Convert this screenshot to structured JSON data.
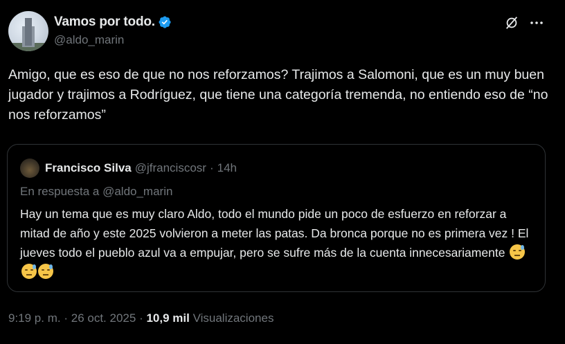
{
  "author": {
    "display_name": "Vamos por todo.",
    "handle": "@aldo_marin"
  },
  "tweet_text": "Amigo, que es eso de que no nos reforzamos?  Trajimos a Salomoni, que es un muy buen jugador y trajimos a Rodríguez, que tiene una categoría tremenda, no entiendo eso de “no nos reforzamos”",
  "quote": {
    "display_name": "Francisco Silva",
    "handle": "@jfranciscosr",
    "separator": "·",
    "time": "14h",
    "reply_to": "En respuesta a @aldo_marin",
    "text": "Hay un tema que es muy claro Aldo, todo el mundo pide un poco de esfuerzo en reforzar a mitad de año y este 2025 volvieron a meter las patas. Da bronca porque no es primera vez ! El jueves todo el pueblo azul va a empujar, pero se sufre más de la cuenta innecesariamente",
    "emoji_name": "sleepy-face-icon"
  },
  "meta": {
    "time": "9:19 p. m.",
    "separator": "·",
    "date": "26 oct. 2025",
    "views_count": "10,9 mil",
    "views_label": "Visualizaciones"
  },
  "colors": {
    "background": "#000000",
    "text": "#e7e9ea",
    "secondary": "#71767b",
    "verified": "#1d9bf0",
    "border": "#2f3336"
  },
  "icons": [
    "verified-badge-icon",
    "grok-icon",
    "more-icon"
  ]
}
